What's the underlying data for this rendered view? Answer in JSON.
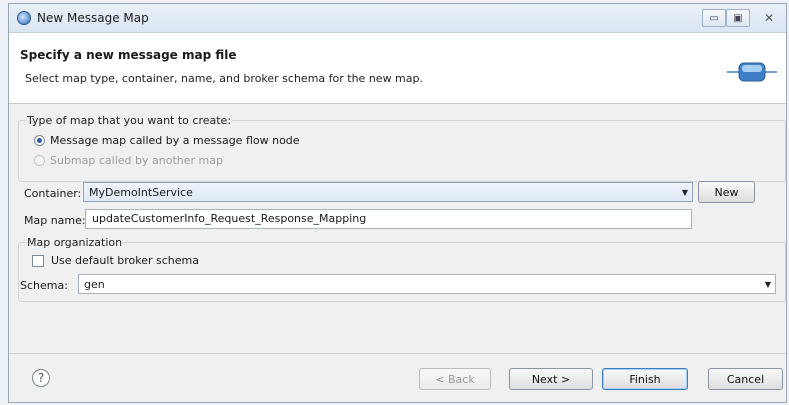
{
  "window": {
    "title": "New Message Map",
    "icon": "message-map-icon",
    "controls": {
      "minimize": "▭",
      "maximize": "▣",
      "close": "✕"
    }
  },
  "header": {
    "title": "Specify a new message map file",
    "description": "Select map type, container, name, and broker schema for the new map.",
    "graphic_icon": "message-map-banner-icon"
  },
  "map_type": {
    "legend": "Type of map that you want to create:",
    "options": [
      {
        "label": "Message map called by a message flow node",
        "selected": true,
        "enabled": true
      },
      {
        "label": "Submap called by another map",
        "selected": false,
        "enabled": false
      }
    ]
  },
  "container": {
    "label": "Container:",
    "value": "MyDemoIntService",
    "new_button": "New"
  },
  "map_name": {
    "label": "Map name:",
    "value": "updateCustomerInfo_Request_Response_Mapping"
  },
  "map_organization": {
    "legend": "Map organization",
    "use_default_schema_label": "Use default broker schema",
    "use_default_schema_checked": false,
    "schema_label": "Schema:",
    "schema_value": "gen"
  },
  "footer": {
    "help_icon": "help-icon",
    "back": "< Back",
    "next": "Next >",
    "finish": "Finish",
    "cancel": "Cancel"
  },
  "colors": {
    "accent": "#3d7cc5",
    "dialog_bg": "#f0f0f0",
    "header_bg": "#ffffff"
  }
}
